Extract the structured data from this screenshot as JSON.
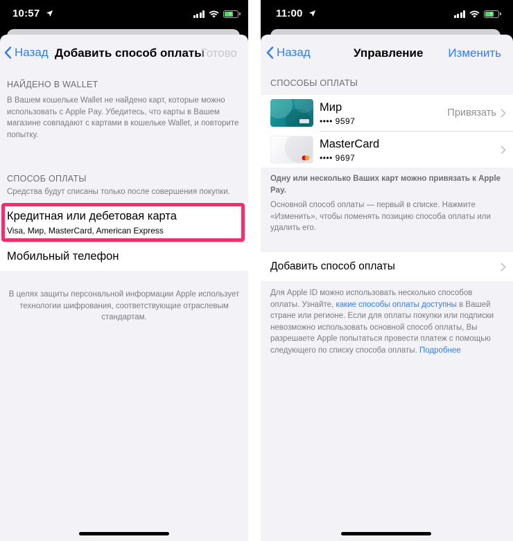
{
  "left": {
    "status": {
      "time": "10:57"
    },
    "nav": {
      "back": "Назад",
      "title": "Добавить способ оплаты",
      "done": "Готово"
    },
    "wallet_section": {
      "header": "НАЙДЕНО В WALLET",
      "text": "В Вашем кошельке Wallet не найдено карт, которые можно использовать с Apple Pay. Убедитесь, что карты в Вашем магазине совпадают с картами в кошельке Wallet, и повторите попытку."
    },
    "payment_section": {
      "header": "СПОСОБ ОПЛАТЫ",
      "subheader": "Средства будут списаны только после совершения покупки.",
      "card_option": {
        "title": "Кредитная или дебетовая карта",
        "subtitle": "Visa, Мир, MasterCard, American Express"
      },
      "phone_option": {
        "title": "Мобильный телефон"
      }
    },
    "privacy_note": "В целях защиты персональной информации Apple использует технологии шифрования, соответствующие отраслевым стандартам.",
    "highlight_color": "#f0306a"
  },
  "right": {
    "status": {
      "time": "11:00"
    },
    "nav": {
      "back": "Назад",
      "title": "Управление",
      "edit": "Изменить"
    },
    "methods_header": "СПОСОБЫ ОПЛАТЫ",
    "cards": [
      {
        "name": "Мир",
        "number": "•••• 9597",
        "action": "Привязать"
      },
      {
        "name": "MasterCard",
        "number": "•••• 9697",
        "action": ""
      }
    ],
    "apple_pay_note": "Одну или несколько Ваших карт можно привязать к Apple Pay.",
    "order_note": "Основной способ оплаты — первый в списке. Нажмите «Изменить», чтобы поменять позицию способа оплаты или удалить его.",
    "add_method": "Добавить способ оплаты",
    "info": {
      "part1": "Для Apple ID можно использовать несколько способов оплаты. Узнайте, ",
      "link1": "какие способы оплаты доступны",
      "part2": " в Вашей стране или регионе. Если для оплаты покупки или подписки невозможно использовать основной способ оплаты, Вы разрешаете Apple попытаться провести платеж с помощью следующего по списку способа оплаты. ",
      "link2": "Подробнее"
    }
  },
  "colors": {
    "accent": "#2f7cf6",
    "background": "#f2f2f7",
    "secondary_text": "#6d6d72"
  }
}
